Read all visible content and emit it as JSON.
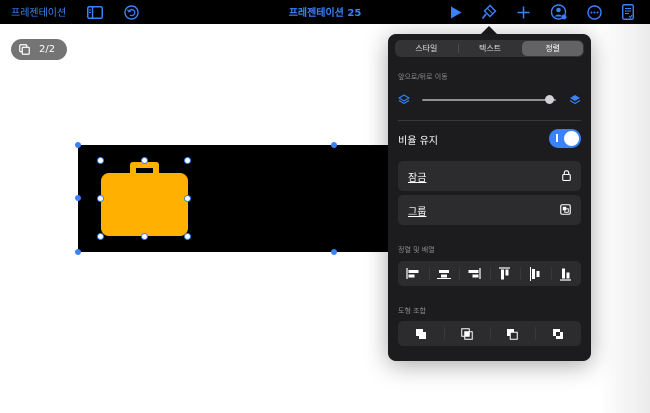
{
  "toolbar": {
    "back_label": "프레젠테이션",
    "title": "프레젠테이션 25",
    "accent_color": "#3a82f7",
    "icons": [
      "sidebar-icon",
      "undo-icon",
      "play-icon",
      "format-brush-icon",
      "add-icon",
      "collaborate-icon",
      "more-icon",
      "document-icon"
    ]
  },
  "canvas": {
    "page_counter": "2/2",
    "shape_color": "#ffb000"
  },
  "popover": {
    "tabs": [
      {
        "label": "스타일",
        "active": false
      },
      {
        "label": "텍스트",
        "active": false
      },
      {
        "label": "정렬",
        "active": true
      }
    ],
    "move_label": "앞으로/뒤로 이동",
    "move_value": 0.95,
    "keep_ratio_label": "비율 유지",
    "keep_ratio_on": true,
    "lock_label": "잠금",
    "group_label": "그룹",
    "align_label": "정렬 및 배열",
    "combine_label": "도형 조합"
  }
}
